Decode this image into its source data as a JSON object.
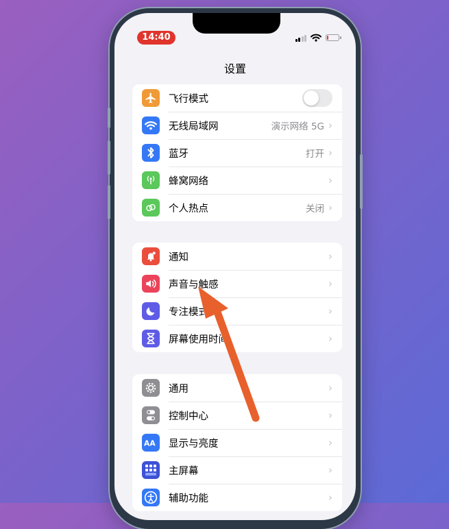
{
  "status_bar": {
    "time": "14:40",
    "battery_level": 0.12
  },
  "nav": {
    "title": "设置"
  },
  "groups": [
    {
      "items": [
        {
          "label": "飞行模式",
          "icon": "airplane-icon",
          "color": "#f09a37",
          "control": "toggle",
          "toggle_on": false
        },
        {
          "label": "无线局域网",
          "icon": "wifi-icon",
          "color": "#3478f6",
          "value": "演示网络 5G"
        },
        {
          "label": "蓝牙",
          "icon": "bluetooth-icon",
          "color": "#3478f6",
          "value": "打开"
        },
        {
          "label": "蜂窝网络",
          "icon": "cellular-icon",
          "color": "#5ac85a"
        },
        {
          "label": "个人热点",
          "icon": "hotspot-icon",
          "color": "#5ac85a",
          "value": "关闭"
        }
      ]
    },
    {
      "items": [
        {
          "label": "通知",
          "icon": "notification-icon",
          "color": "#eb4d3d"
        },
        {
          "label": "声音与触感",
          "icon": "sound-icon",
          "color": "#eb445a"
        },
        {
          "label": "专注模式",
          "icon": "moon-icon",
          "color": "#5e5ce6"
        },
        {
          "label": "屏幕使用时间",
          "icon": "hourglass-icon",
          "color": "#5e5ce6"
        }
      ]
    },
    {
      "items": [
        {
          "label": "通用",
          "icon": "gear-icon",
          "color": "#8e8e93"
        },
        {
          "label": "控制中心",
          "icon": "switches-icon",
          "color": "#8e8e93"
        },
        {
          "label": "显示与亮度",
          "icon": "aa-icon",
          "color": "#3478f6"
        },
        {
          "label": "主屏幕",
          "icon": "home-screen-icon",
          "color": "#3d52d5"
        },
        {
          "label": "辅助功能",
          "icon": "accessibility-icon",
          "color": "#3478f6"
        }
      ]
    }
  ],
  "annotation": {
    "arrow_color": "#e8602c"
  }
}
